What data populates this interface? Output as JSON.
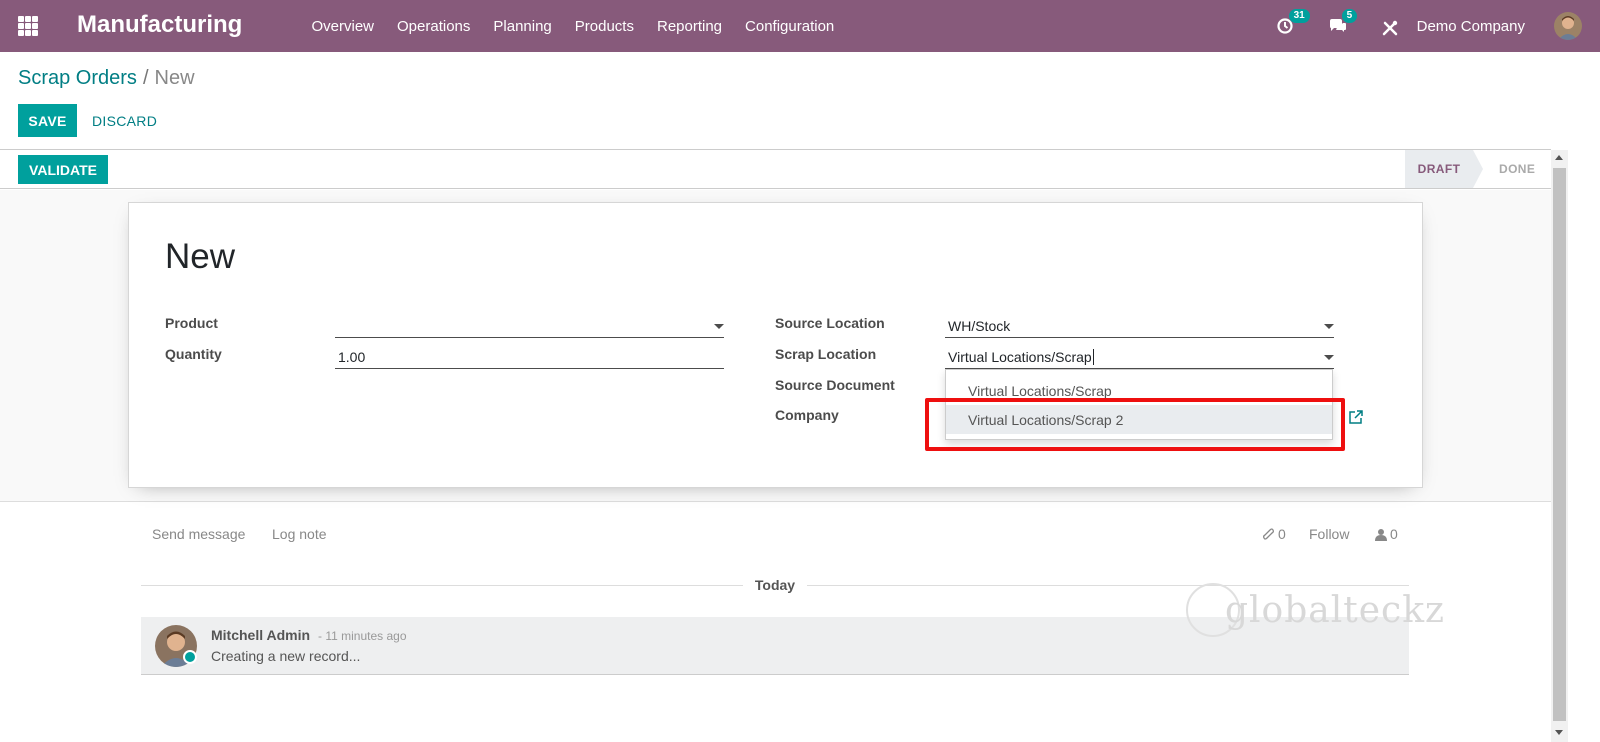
{
  "navbar": {
    "app_name": "Manufacturing",
    "menu": [
      "Overview",
      "Operations",
      "Planning",
      "Products",
      "Reporting",
      "Configuration"
    ],
    "activity_count": "31",
    "message_count": "5",
    "company": "Demo Company",
    "bg_color": "#875a7b"
  },
  "breadcrumb": {
    "parent": "Scrap Orders",
    "separator": "/",
    "current": "New"
  },
  "buttons": {
    "save": "SAVE",
    "discard": "DISCARD",
    "validate": "VALIDATE"
  },
  "statusbar": {
    "stages": [
      "DRAFT",
      "DONE"
    ],
    "active": "DRAFT"
  },
  "form": {
    "title": "New",
    "product_label": "Product",
    "product_value": "",
    "quantity_label": "Quantity",
    "quantity_value": "1.00",
    "source_location_label": "Source Location",
    "source_location_value": "WH/Stock",
    "scrap_location_label": "Scrap Location",
    "scrap_location_value": "Virtual Locations/Scrap",
    "source_document_label": "Source Document",
    "company_label": "Company"
  },
  "dropdown": {
    "options": [
      "Virtual Locations/Scrap",
      "Virtual Locations/Scrap 2"
    ],
    "highlighted": "Virtual Locations/Scrap 2"
  },
  "chatter": {
    "send_message": "Send message",
    "log_note": "Log note",
    "attachments": "0",
    "follow": "Follow",
    "followers": "0",
    "date_separator": "Today",
    "message": {
      "author": "Mitchell Admin",
      "date": "- 11 minutes ago",
      "body": "Creating a new record..."
    }
  },
  "watermark": "globalteckz",
  "colors": {
    "accent": "#00a09d",
    "link": "#017e84",
    "highlight": "#ee0f0f"
  }
}
